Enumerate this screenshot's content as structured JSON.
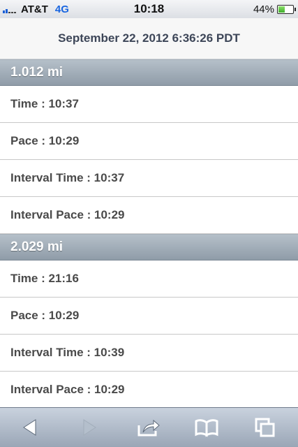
{
  "status_bar": {
    "carrier": "AT&T",
    "network": "4G",
    "time": "10:18",
    "battery_percent": "44%",
    "battery_level": 0.44
  },
  "header": {
    "title": "September 22, 2012 6:36:26 PDT"
  },
  "splits": [
    {
      "distance": "1.012 mi",
      "rows": [
        "Time : 10:37",
        "Pace : 10:29",
        "Interval Time : 10:37",
        "Interval Pace : 10:29"
      ]
    },
    {
      "distance": "2.029 mi",
      "rows": [
        "Time : 21:16",
        "Pace : 10:29",
        "Interval Time : 10:39",
        "Interval Pace : 10:29"
      ]
    }
  ],
  "toolbar": {
    "icons": [
      "back-icon",
      "forward-icon",
      "share-icon",
      "bookmarks-icon",
      "pages-icon"
    ]
  }
}
